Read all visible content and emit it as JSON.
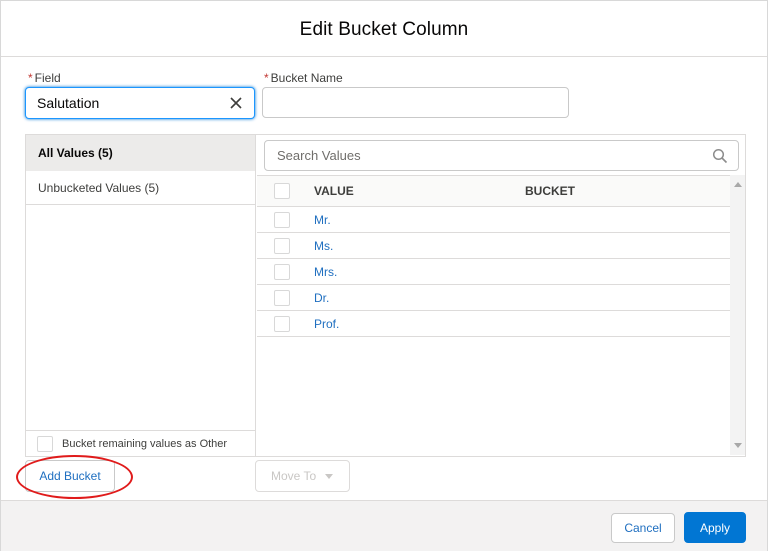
{
  "modal": {
    "title": "Edit Bucket Column"
  },
  "field": {
    "required_marker": "*",
    "label": "Field",
    "value": "Salutation",
    "clear_icon": "close-icon"
  },
  "bucket_name": {
    "required_marker": "*",
    "label": "Bucket Name",
    "value": ""
  },
  "left_panel": {
    "all_values": "All Values (5)",
    "unbucketed_values": "Unbucketed Values (5)",
    "remaining_checkbox_label": "Bucket remaining values as Other"
  },
  "search": {
    "placeholder": "Search Values",
    "icon": "search-icon"
  },
  "table": {
    "headers": {
      "value": "VALUE",
      "bucket": "BUCKET"
    },
    "rows": [
      {
        "value": "Mr.",
        "bucket": ""
      },
      {
        "value": "Ms.",
        "bucket": ""
      },
      {
        "value": "Mrs.",
        "bucket": ""
      },
      {
        "value": "Dr.",
        "bucket": ""
      },
      {
        "value": "Prof.",
        "bucket": ""
      }
    ]
  },
  "actions": {
    "add_bucket": "Add Bucket",
    "move_to": "Move To"
  },
  "footer": {
    "cancel": "Cancel",
    "apply": "Apply"
  },
  "colors": {
    "brand_blue": "#0176d3",
    "link_blue": "#1f6fc0",
    "annotation_red": "#e01b1b",
    "required_red": "#c23934"
  }
}
